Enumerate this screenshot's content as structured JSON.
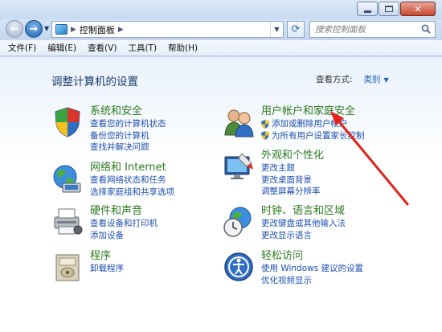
{
  "window": {
    "min_label": "",
    "max_label": "",
    "close_label": "✕"
  },
  "address": {
    "crumb": "控制面板",
    "search_placeholder": "搜索控制面板"
  },
  "menu": [
    "文件(F)",
    "编辑(E)",
    "查看(V)",
    "工具(T)",
    "帮助(H)"
  ],
  "page": {
    "title": "调整计算机的设置",
    "viewby_label": "查看方式:",
    "viewby_value": "类别"
  },
  "categories": [
    {
      "title": "系统和安全",
      "icon": "system-security-icon",
      "links": [
        "查看您的计算机状态",
        "备份您的计算机",
        "查找并解决问题"
      ]
    },
    {
      "title": "网络和 Internet",
      "icon": "network-internet-icon",
      "links": [
        "查看网络状态和任务",
        "选择家庭组和共享选项"
      ]
    },
    {
      "title": "硬件和声音",
      "icon": "hardware-sound-icon",
      "links": [
        "查看设备和打印机",
        "添加设备"
      ]
    },
    {
      "title": "程序",
      "icon": "programs-icon",
      "links": [
        "卸载程序"
      ]
    },
    {
      "title": "用户帐户和家庭安全",
      "icon": "user-accounts-icon",
      "links": [
        "添加或删除用户帐户",
        "为所有用户设置家长控制"
      ]
    },
    {
      "title": "外观和个性化",
      "icon": "appearance-icon",
      "links": [
        "更改主题",
        "更改桌面背景",
        "调整屏幕分辨率"
      ]
    },
    {
      "title": "时钟、语言和区域",
      "icon": "clock-language-icon",
      "links": [
        "更改键盘或其他输入法",
        "更改显示语言"
      ]
    },
    {
      "title": "轻松访问",
      "icon": "ease-of-access-icon",
      "links": [
        "使用 Windows 建议的设置",
        "优化视频显示"
      ]
    }
  ],
  "colors": {
    "category_title": "#2b7a1e",
    "link": "#1c4fae",
    "annotation_arrow": "#e0231c"
  }
}
